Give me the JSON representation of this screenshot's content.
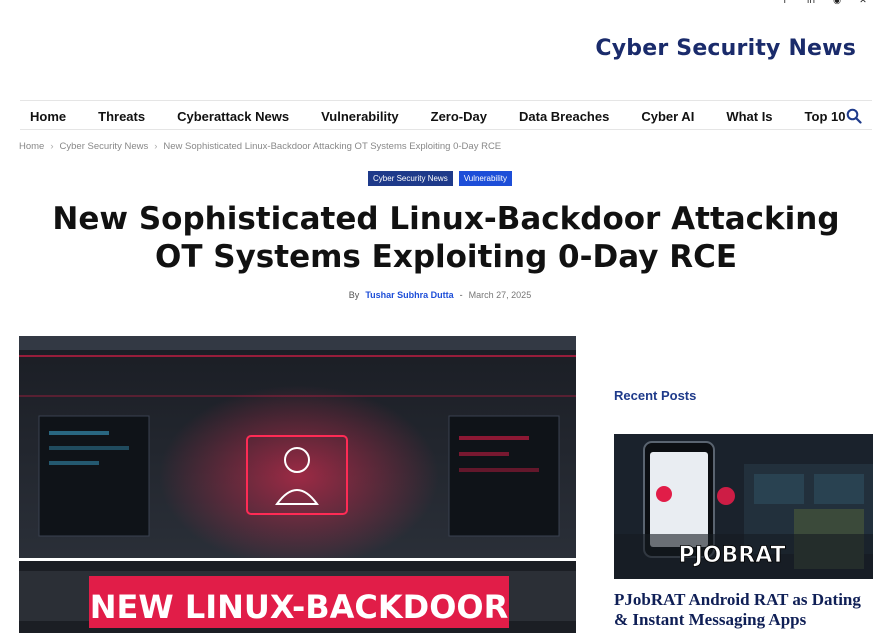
{
  "header": {
    "logo_text": "Cyber Security News",
    "social_icons": [
      "facebook-icon",
      "linkedin-icon",
      "rss-icon",
      "x-icon"
    ]
  },
  "nav": {
    "items": [
      "Home",
      "Threats",
      "Cyberattack News",
      "Vulnerability",
      "Zero-Day",
      "Data Breaches",
      "Cyber AI",
      "What Is",
      "Top 10"
    ]
  },
  "breadcrumb": {
    "items": [
      "Home",
      "Cyber Security News",
      "New Sophisticated Linux-Backdoor Attacking OT Systems Exploiting 0-Day RCE"
    ]
  },
  "article": {
    "categories": [
      "Cyber Security News",
      "Vulnerability"
    ],
    "title_line1": "New Sophisticated Linux-Backdoor Attacking",
    "title_line2": "OT Systems Exploiting 0-Day RCE",
    "by_label": "By",
    "author": "Tushar Subhra Dutta",
    "separator": "-",
    "date": "March 27, 2025",
    "hero_banner_text": "NEW LINUX-BACKDOOR"
  },
  "sidebar": {
    "heading": "Recent Posts",
    "posts": [
      {
        "thumb_text": "PJOBRAT",
        "title": "PJobRAT Android RAT as Dating & Instant Messaging Apps"
      }
    ]
  },
  "colors": {
    "brand_navy": "#1e3a8a",
    "accent_blue": "#1d4ed8",
    "hero_red": "#e11d48"
  }
}
